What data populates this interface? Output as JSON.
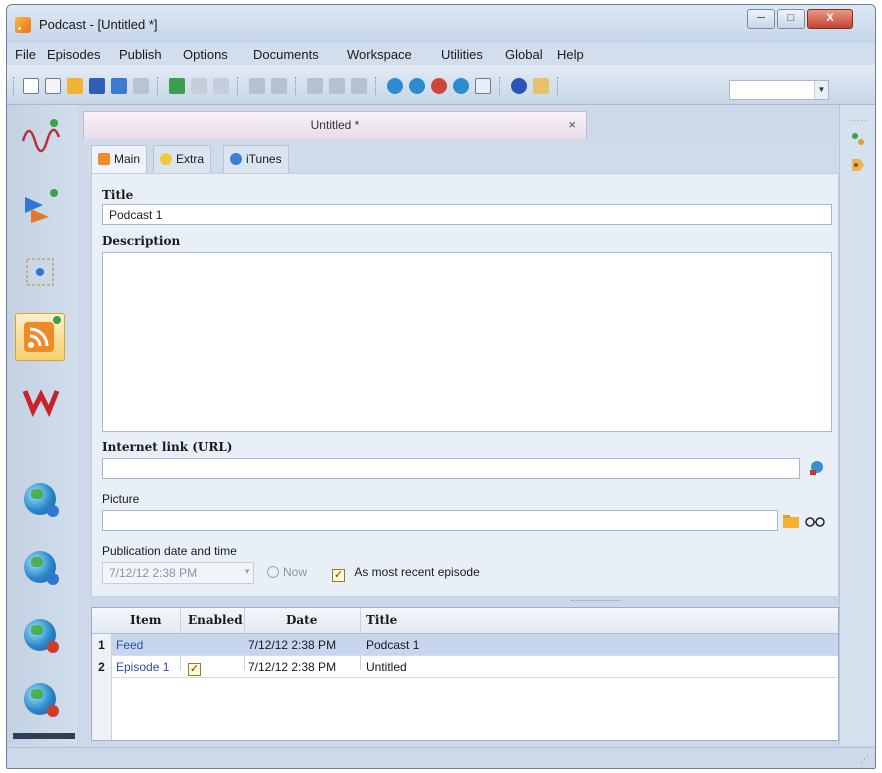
{
  "window": {
    "title": "Podcast - [Untitled *]",
    "controls": {
      "minimize": "─",
      "maximize": "□",
      "close": "X"
    }
  },
  "menu": [
    "File",
    "Episodes",
    "Publish",
    "Options",
    "Documents",
    "Workspace",
    "Utilities",
    "Global",
    "Help"
  ],
  "document": {
    "tab_title": "Untitled *",
    "close": "×",
    "subtabs": [
      "Main",
      "Extra",
      "iTunes"
    ]
  },
  "form": {
    "title_label": "Title",
    "title_value": "Podcast 1",
    "description_label": "Description",
    "description_value": "",
    "url_label": "Internet link (URL)",
    "url_value": "",
    "picture_label": "Picture",
    "picture_value": "",
    "pubdate_label": "Publication date and time",
    "pubdate_value": "7/12/12 2:38 PM",
    "now_label": "Now",
    "recent_label": "As most recent episode",
    "recent_checked": "✓"
  },
  "grid": {
    "columns": [
      "Item",
      "Enabled",
      "Date",
      "Title"
    ],
    "rows": [
      {
        "num": "1",
        "item": "Feed",
        "enabled": "",
        "date": "7/12/12 2:38 PM",
        "title": "Podcast 1"
      },
      {
        "num": "2",
        "item": "Episode 1",
        "enabled": "✓",
        "date": "7/12/12 2:38 PM",
        "title": "Untitled"
      }
    ]
  },
  "toolbar": {
    "combo_value": "",
    "combo_arrow": "▼"
  },
  "rightbar": {
    "dots": "....."
  },
  "statusbar": {
    "grip": "⋰"
  },
  "colors": {
    "accent": "#f6cf6e",
    "selection": "#c7d6ee",
    "link": "#2a4fa8"
  }
}
